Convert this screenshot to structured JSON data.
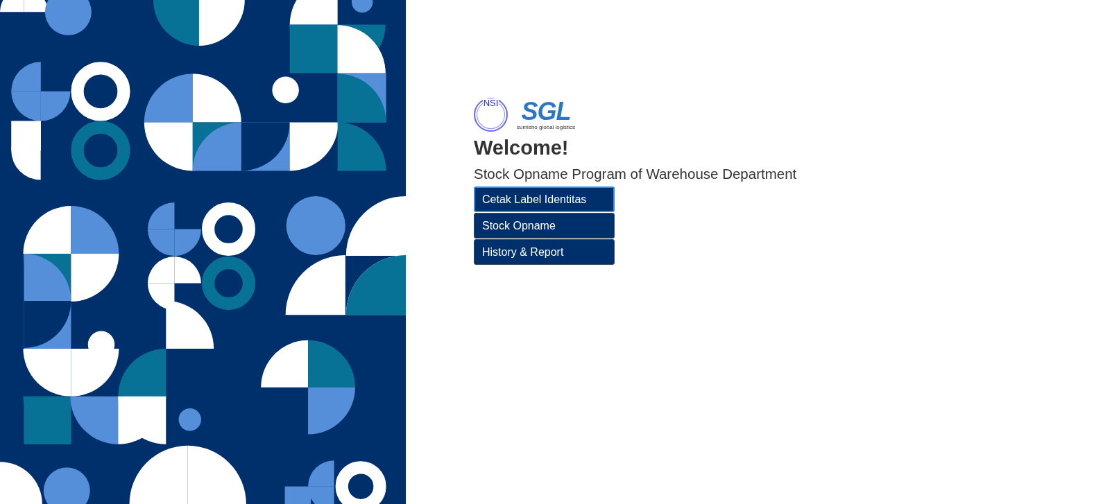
{
  "logos": {
    "nsi": "NSI",
    "sgl": "SGL",
    "sgl_tagline": "sumisho global logistics"
  },
  "heading": "Welcome!",
  "subtitle": "Stock Opname Program of Warehouse Department",
  "buttons": [
    {
      "label": "Cetak Label Identitas",
      "focused": true
    },
    {
      "label": "Stock Opname",
      "focused": false
    },
    {
      "label": "History & Report",
      "focused": false
    }
  ]
}
